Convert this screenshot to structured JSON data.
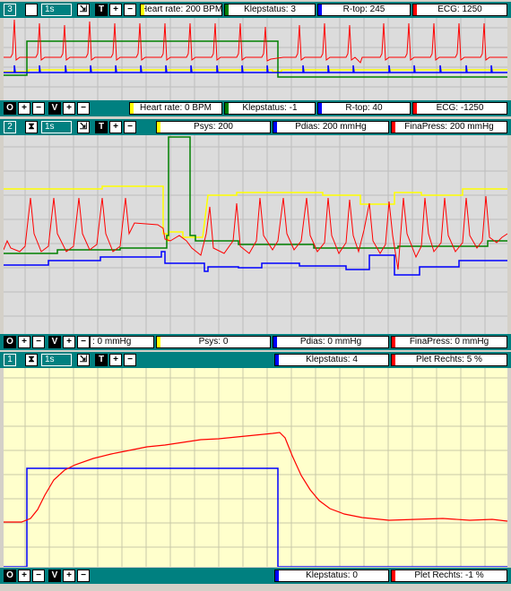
{
  "colors": {
    "teal": "#008080",
    "red": "#ff0000",
    "green": "#008000",
    "blue": "#0000ff",
    "yellow": "#ffff00",
    "plot_gray": "#dcdcdc",
    "plot_cream": "#ffffcc"
  },
  "panel1": {
    "number": "3",
    "timebase": "1s",
    "t_label": "T",
    "o_label": "O",
    "v_label": "V",
    "top": [
      {
        "label": "Heart rate: 200 BPM",
        "color": "#ffff00"
      },
      {
        "label": "Klepstatus: 3",
        "color": "#008000"
      },
      {
        "label": "R-top: 245",
        "color": "#0000ff"
      },
      {
        "label": "ECG: 1250",
        "color": "#ff0000"
      }
    ],
    "bottom": [
      {
        "label": "Heart rate: 0 BPM",
        "color": "#ffff00"
      },
      {
        "label": "Klepstatus: -1",
        "color": "#008000"
      },
      {
        "label": "R-top: 40",
        "color": "#0000ff"
      },
      {
        "label": "ECG: -1250",
        "color": "#ff0000"
      }
    ]
  },
  "panel2": {
    "number": "2",
    "timebase": "1s",
    "t_label": "T",
    "o_label": "O",
    "v_label": "V",
    "top": [
      {
        "label": "Psys: 200",
        "color": "#ffff00"
      },
      {
        "label": "Pdias: 200 mmHg",
        "color": "#0000ff"
      },
      {
        "label": "FinaPress: 200 mmHg",
        "color": "#ff0000"
      }
    ],
    "bottom_partial": ": 0 mmHg",
    "bottom": [
      {
        "label": "Psys: 0",
        "color": "#ffff00"
      },
      {
        "label": "Pdias: 0 mmHg",
        "color": "#0000ff"
      },
      {
        "label": "FinaPress: 0 mmHg",
        "color": "#ff0000"
      }
    ]
  },
  "panel3": {
    "number": "1",
    "timebase": "1s",
    "t_label": "T",
    "o_label": "O",
    "v_label": "V",
    "top": [
      {
        "label": "Klepstatus: 4",
        "color": "#0000ff"
      },
      {
        "label": "Plet Rechts: 5 %",
        "color": "#ff0000"
      }
    ],
    "bottom": [
      {
        "label": "Klepstatus: 0",
        "color": "#0000ff"
      },
      {
        "label": "Plet Rechts: -1 %",
        "color": "#ff0000"
      }
    ]
  }
}
